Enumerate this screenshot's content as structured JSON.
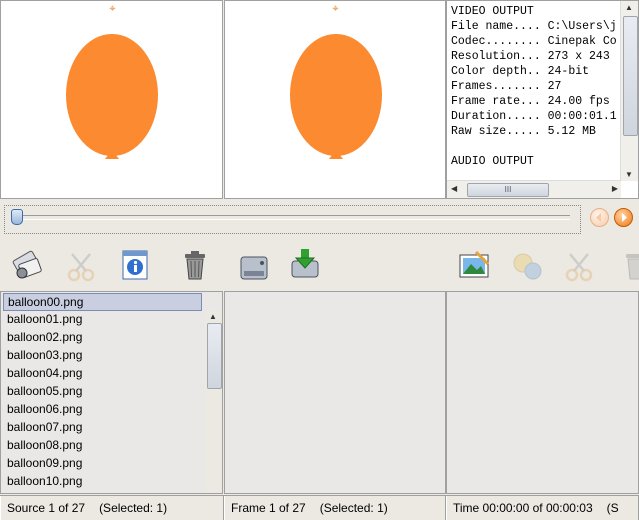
{
  "preview": {
    "source_label": "source-preview",
    "frame_label": "frame-preview"
  },
  "info": {
    "lines": [
      "VIDEO OUTPUT",
      "File name.... C:\\Users\\j",
      "Codec........ Cinepak Co",
      "Resolution... 273 x 243",
      "Color depth.. 24-bit",
      "Frames....... 27",
      "Frame rate... 24.00 fps",
      "Duration..... 00:00:01.1",
      "Raw size..... 5.12 MB",
      "",
      "AUDIO OUTPUT"
    ],
    "hscroll_grip": "III"
  },
  "timeline": {
    "position_fraction": 0.0
  },
  "toolbar": {
    "icons": [
      "film-edit-icon",
      "cut-icon",
      "info-icon",
      "trash-icon",
      "disk-icon",
      "save-download-icon",
      "image-edit-icon",
      "gears-icon",
      "cut-icon",
      "trash-icon"
    ]
  },
  "source_list": {
    "items": [
      "balloon00.png",
      "balloon01.png",
      "balloon02.png",
      "balloon03.png",
      "balloon04.png",
      "balloon05.png",
      "balloon06.png",
      "balloon07.png",
      "balloon08.png",
      "balloon09.png",
      "balloon10.png"
    ],
    "selected_index": 0
  },
  "status": {
    "source": "Source 1 of 27",
    "source_selected": "(Selected: 1)",
    "frame": "Frame 1 of 27",
    "frame_selected": "(Selected: 1)",
    "time": "Time 00:00:00 of 00:00:03",
    "time_extra": "(S"
  },
  "colors": {
    "balloon": "#fb8a30",
    "selection": "#c9cfe0",
    "background": "#ece9e3"
  }
}
